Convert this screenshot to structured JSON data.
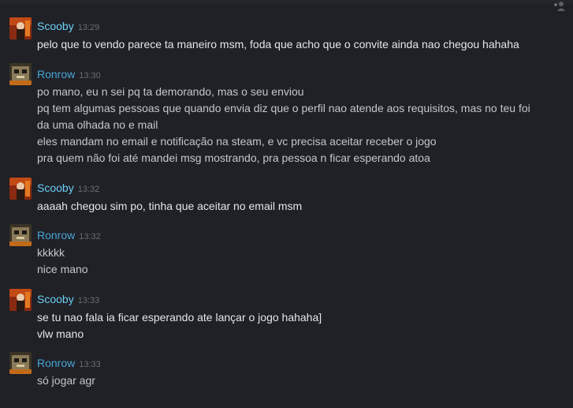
{
  "messages": [
    {
      "sender": "Scooby",
      "time": "13:29",
      "lines": [
        "pelo que to vendo parece ta maneiro msm, foda que acho que o convite ainda nao chegou hahaha"
      ]
    },
    {
      "sender": "Ronrow",
      "time": "13:30",
      "lines": [
        "po mano, eu n sei pq ta demorando, mas o seu enviou",
        "pq tem algumas pessoas que quando envia diz que o perfil nao atende aos requisitos, mas no teu foi",
        "da uma olhada no e mail",
        "eles mandam no email e notificação na steam, e vc precisa aceitar receber o jogo",
        "pra quem não foi até mandei msg mostrando, pra pessoa n ficar esperando atoa"
      ]
    },
    {
      "sender": "Scooby",
      "time": "13:32",
      "lines": [
        "aaaah chegou sim po, tinha que aceitar no email msm"
      ]
    },
    {
      "sender": "Ronrow",
      "time": "13:32",
      "lines": [
        "kkkkk",
        "nice mano"
      ]
    },
    {
      "sender": "Scooby",
      "time": "13:33",
      "lines": [
        "se tu nao fala ia ficar esperando ate lançar o jogo hahaha]",
        "vlw mano"
      ]
    },
    {
      "sender": "Ronrow",
      "time": "13:33",
      "lines": [
        "só jogar agr"
      ]
    }
  ],
  "icons": {
    "top_right": "add-friend-icon",
    "scooby_avatar": "scooby-avatar-icon",
    "ronrow_avatar": "ronrow-avatar-icon"
  },
  "colors": {
    "background": "#1f2127",
    "scooby_name": "#6dcff6",
    "ronrow_name": "#4aa6d6",
    "timestamp": "#6a6e76",
    "text": "#e6e6e6"
  }
}
